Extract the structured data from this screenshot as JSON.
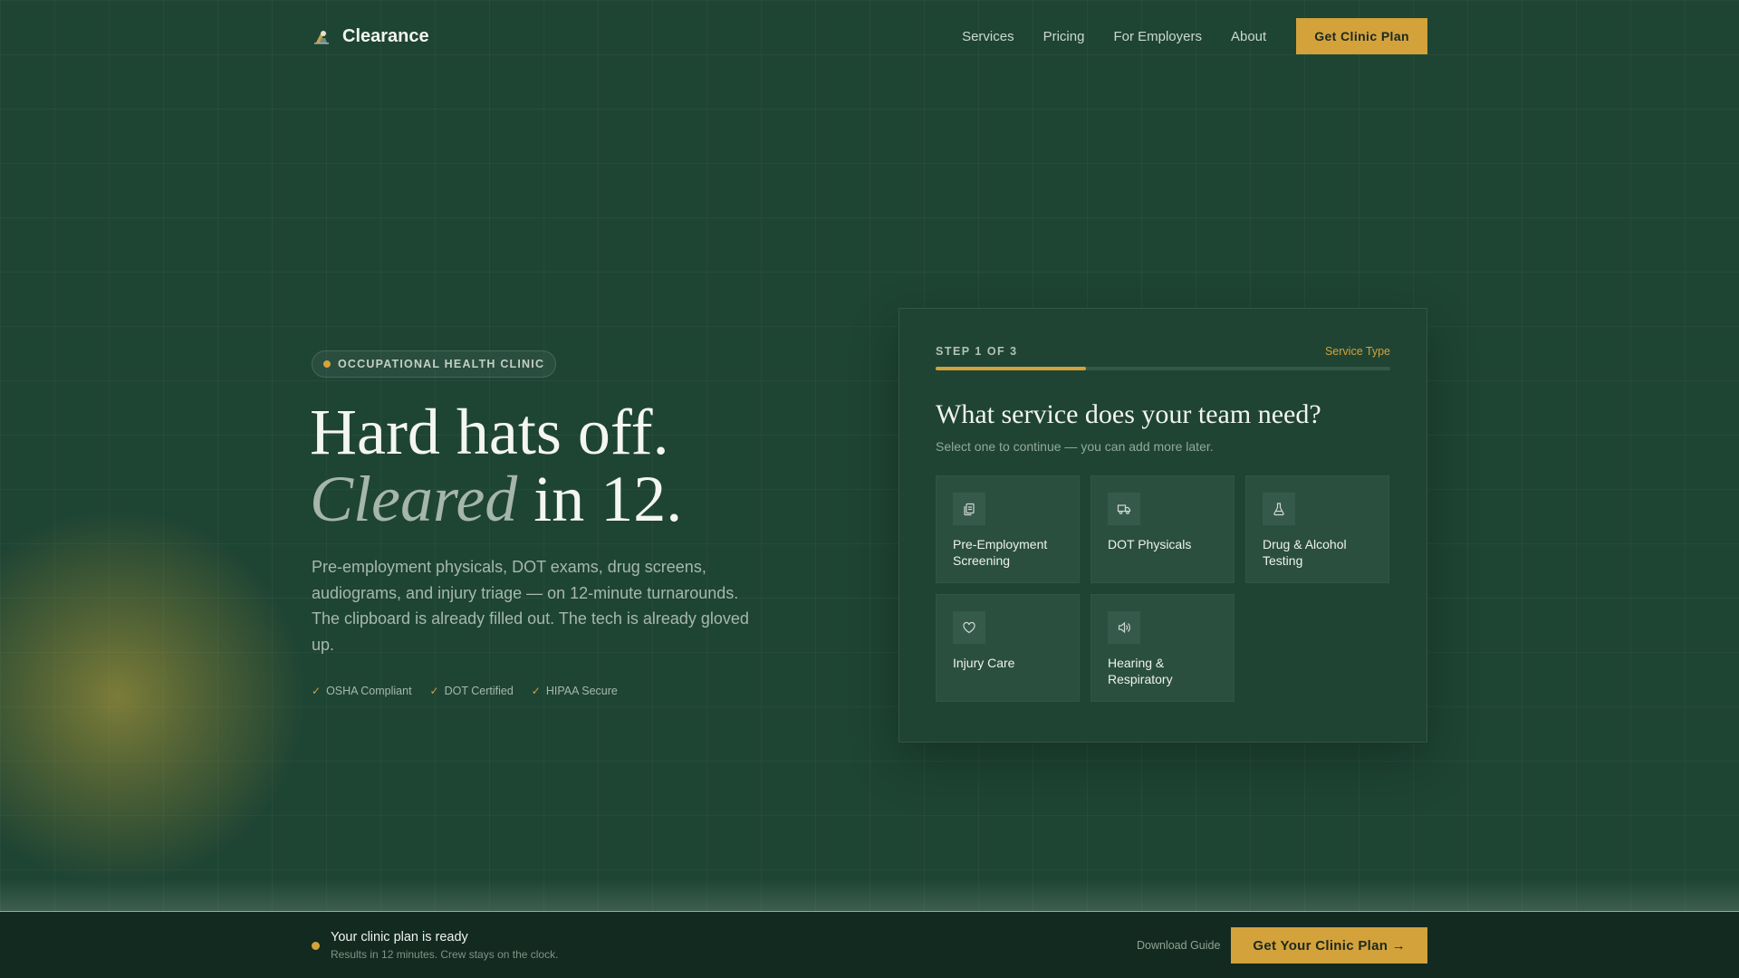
{
  "brand": {
    "name": "Clearance",
    "logo_icon": "hard-hat-worker-icon"
  },
  "nav": {
    "links": [
      "Services",
      "Pricing",
      "For Employers",
      "About"
    ],
    "cta": "Get Clinic Plan"
  },
  "hero": {
    "badge": "OCCUPATIONAL HEALTH CLINIC",
    "headline_line1": "Hard hats off.",
    "headline_italic": "Cleared",
    "headline_rest": " in 12.",
    "lede": "Pre-employment physicals, DOT exams, drug screens, audiograms, and injury triage — on 12-minute turnarounds. The clipboard is already filled out. The tech is already gloved up.",
    "trust": [
      "OSHA Compliant",
      "DOT Certified",
      "HIPAA Secure"
    ]
  },
  "form": {
    "step_label": "STEP 1 OF 3",
    "step_name": "Service Type",
    "progress": 0.33,
    "title": "What service does your team need?",
    "subtitle": "Select one to continue — you can add more later.",
    "options": [
      {
        "label": "Pre-Employment Screening",
        "icon": "clipboard-copy-icon"
      },
      {
        "label": "DOT Physicals",
        "icon": "truck-icon"
      },
      {
        "label": "Drug & Alcohol Testing",
        "icon": "flask-icon"
      },
      {
        "label": "Injury Care",
        "icon": "heart-icon"
      },
      {
        "label": "Hearing & Respiratory",
        "icon": "speaker-icon"
      }
    ]
  },
  "sticky": {
    "title": "Your clinic plan is ready",
    "subtitle": "Results in 12 minutes. Crew stays on the clock.",
    "download": "Download Guide",
    "cta": "Get Your Clinic Plan →"
  },
  "colors": {
    "accent": "#d4a23b",
    "background": "#1e4434",
    "card": "#1f4433"
  }
}
